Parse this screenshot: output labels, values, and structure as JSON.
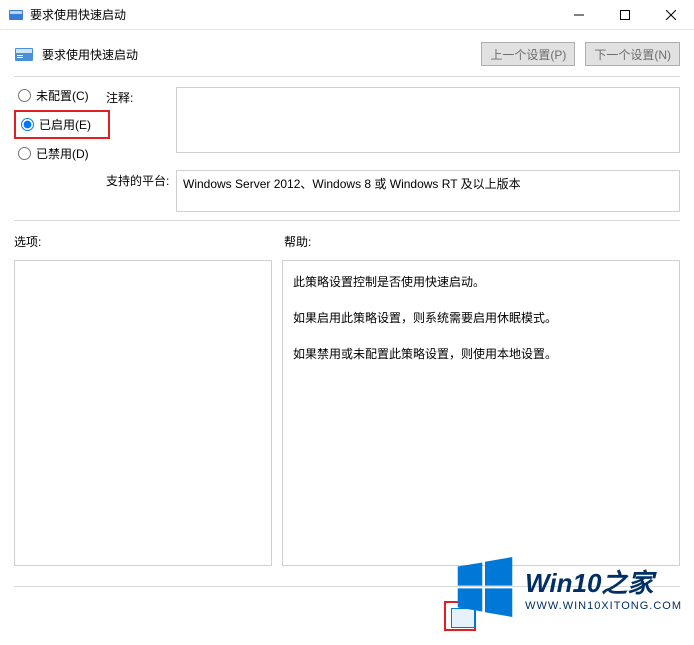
{
  "window": {
    "title": "要求使用快速启动"
  },
  "header": {
    "title": "要求使用快速启动",
    "prev_button": "上一个设置(P)",
    "next_button": "下一个设置(N)"
  },
  "radios": {
    "not_configured": "未配置(C)",
    "enabled": "已启用(E)",
    "disabled": "已禁用(D)",
    "selected": "enabled"
  },
  "labels": {
    "comment": "注释:",
    "platform": "支持的平台:",
    "options": "选项:",
    "help": "帮助:"
  },
  "comment": "",
  "platform": "Windows Server 2012、Windows 8 或 Windows RT 及以上版本",
  "help": {
    "p1": "此策略设置控制是否使用快速启动。",
    "p2": "如果启用此策略设置，则系统需要启用休眠模式。",
    "p3": "如果禁用或未配置此策略设置，则使用本地设置。"
  },
  "watermark": {
    "title": "Win10之家",
    "url": "WWW.WIN10XITONG.COM"
  }
}
